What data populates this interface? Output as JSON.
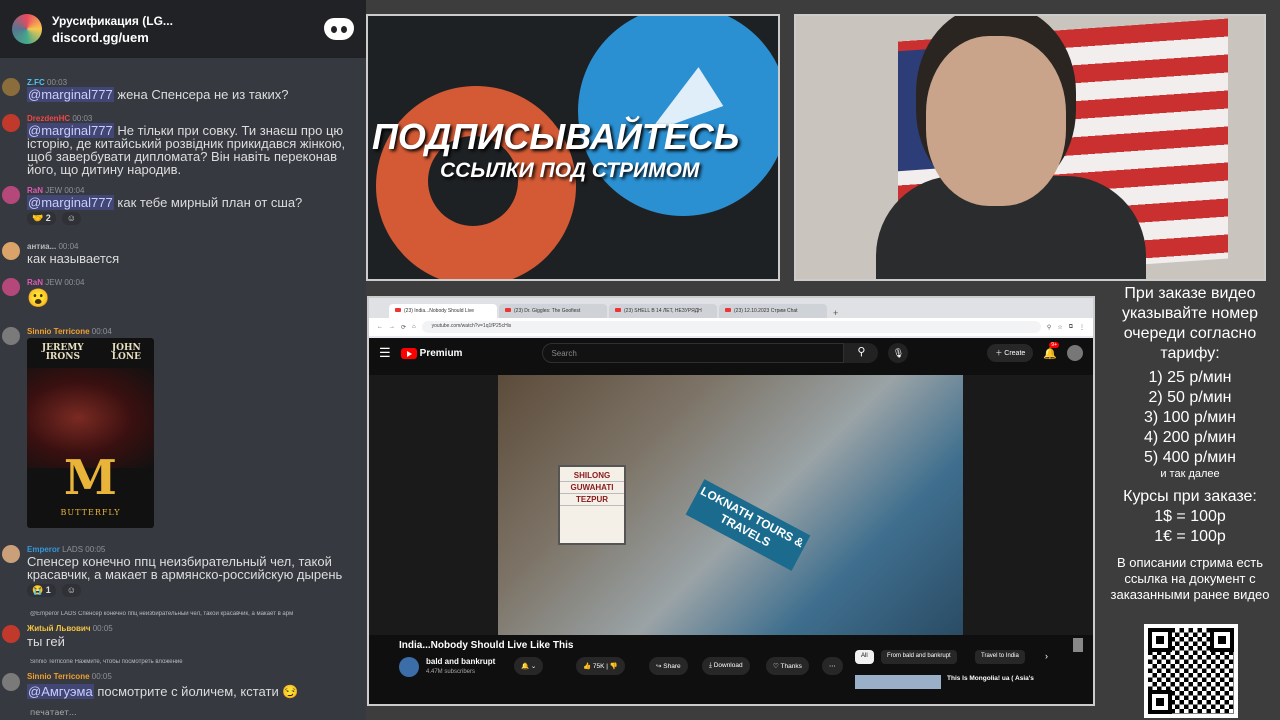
{
  "discord": {
    "server_name": "Урусификация (LG...",
    "invite": "discord.gg/uem",
    "messages": [
      {
        "user": "Z.FC",
        "time": "00:03",
        "mention": "@marginal777",
        "text": "жена Спенсера не из таких?",
        "user_color": "#4fc3f7",
        "avatar_color": "#8a6d3b"
      },
      {
        "user": "DrezdenHC",
        "time": "00:03",
        "mention": "@marginal777",
        "text": "Не тільки при совку. Ти знаєш про цю історію, де китайський розвідник прикидався жінкою, щоб завербувати дипломата? Він навіть переконав його, що дитину народив.",
        "user_color": "#f04747",
        "avatar_color": "#c0392b"
      },
      {
        "user": "RaN",
        "badge": "JEW",
        "time": "00:04",
        "mention": "@marginal777",
        "text": "как тебе мирный план от сша?",
        "reaction_count": "2",
        "user_color": "#e05ab5",
        "avatar_color": "#b5487a"
      },
      {
        "user": "антиа...",
        "time": "00:04",
        "text": "как называется",
        "user_color": "#b9bbbe",
        "avatar_color": "#d9a36a"
      },
      {
        "user": "RaN",
        "badge": "JEW",
        "time": "00:04",
        "text": "😮",
        "user_color": "#e05ab5",
        "avatar_color": "#b5487a"
      },
      {
        "user": "Sinnio Terricone",
        "time": "00:04",
        "user_color": "#f0a030",
        "avatar_color": "#7a7a7a"
      },
      {
        "user": "Emperor",
        "badge": "LADS",
        "time": "00:05",
        "text": "Спенсер конечно ппц неизбирательный чел, такой красавчик, а макает в армянско-российскую дырень",
        "reaction_count": "1",
        "user_color": "#3498db",
        "avatar_color": "#c9a07a"
      },
      {
        "reply_preview": "@Emperor LADS Спенсер конечно ппц неизбирательный чел, такой красавчик, а макает в арм",
        "user": "Жиtый Львович",
        "time": "00:05",
        "text": "ты гей",
        "user_color": "#f5c542",
        "avatar_color": "#c0392b"
      },
      {
        "reply_preview": "Sinnio Terricone Нажмите, чтобы посмотреть вложение",
        "user": "Sinnio Terricone",
        "time": "00:05",
        "mention": "@Амгуэма",
        "text": "посмотрите с йоличем, кстати 😏",
        "user_color": "#f0a030",
        "avatar_color": "#7a7a7a"
      }
    ],
    "poster": {
      "actor1": "JEREMY IRONS",
      "actor2": "JOHN LONE",
      "letter": "M",
      "title": "BUTTERFLY"
    },
    "typing": "печатает..."
  },
  "banner": {
    "title": "ПОДПИСЫВАЙТЕСЬ",
    "subtitle": "ССЫЛКИ ПОД СТРИМОМ"
  },
  "browser": {
    "tabs": [
      "(23) India...Nobody Should Live",
      "(23) Dr. Giggles: The Goofiest",
      "(23) SHELL В 14 ЛЕТ, НЕЗУРЯДН",
      "(23) 12.10.2023 Стрим Chat"
    ],
    "url": "youtube.com/watch?v=1q1fP25cHis"
  },
  "youtube": {
    "logo": "Premium",
    "search_placeholder": "Search",
    "create": "Create",
    "notif_count": "9+",
    "video_title": "India...Nobody Should Live Like This",
    "channel": "bald and bankrupt",
    "subscribers": "4.47M subscribers",
    "likes": "75K",
    "share": "Share",
    "download": "Download",
    "thanks": "Thanks",
    "chips": [
      "All",
      "From bald and bankrupt",
      "Travel to India"
    ],
    "rec_title": "This Is Mongolia! ua ( Asia's",
    "sign": [
      "SHILONG",
      "GUWAHATI",
      "TEZPUR"
    ],
    "board": "LOKNATH TOURS & TRAVELS"
  },
  "order": {
    "heading": "При заказе видео указывайте номер очереди согласно тарифу:",
    "tariffs": [
      "1) 25 р/мин",
      "2) 50 р/мин",
      "3) 100 р/мин",
      "4) 200 р/мин",
      "5) 400 р/мин"
    ],
    "etc": "и так далее",
    "rates_heading": "Курсы при заказе:",
    "rates": [
      "1$ = 100р",
      "1€ = 100р"
    ],
    "note": "В описании стрима есть ссылка на документ с заказанными ранее видео"
  }
}
